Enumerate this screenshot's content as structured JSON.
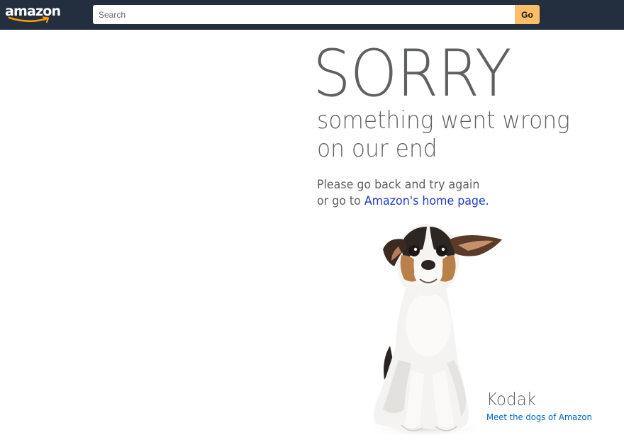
{
  "header": {
    "logo_text": "amazon",
    "search": {
      "placeholder": "Search",
      "value": ""
    },
    "go_label": "Go",
    "colors": {
      "bar": "#232f3e",
      "go_button": "#febd69"
    }
  },
  "error": {
    "headline": "SORRY",
    "subtitle_lines": [
      "something went wrong",
      "on our end"
    ],
    "instruction_line1": "Please go back and try again",
    "instruction_prefix": "or go to ",
    "home_link": "Amazon's home page."
  },
  "dog": {
    "image_icon": "dog-photo",
    "name": "Kodak",
    "link": "Meet the dogs of Amazon"
  }
}
